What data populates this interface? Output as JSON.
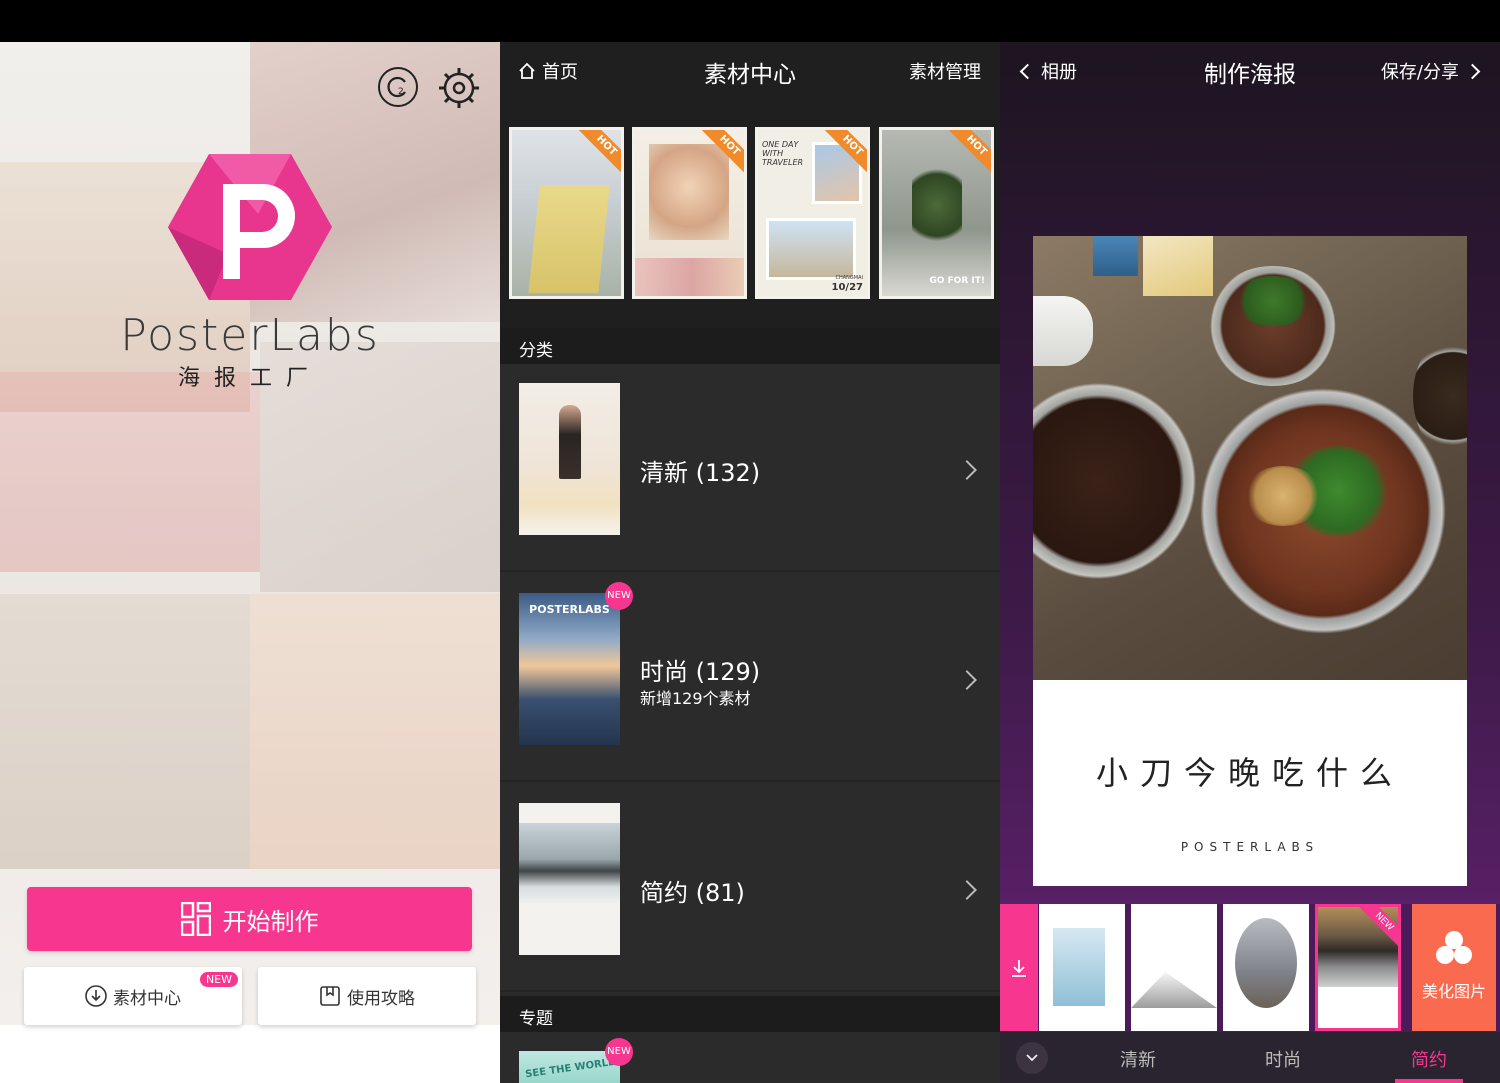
{
  "home": {
    "brand_en": "PosterLabs",
    "brand_cn": "海报工厂",
    "start_label": "开始制作",
    "material_label": "素材中心",
    "material_badge": "NEW",
    "guide_label": "使用攻略",
    "logo_letter": "P"
  },
  "material_center": {
    "home_label": "首页",
    "title": "素材中心",
    "manage_label": "素材管理",
    "hot_badge": "HOT",
    "hot_items": [
      {
        "icon": "poster-street-thumbnail"
      },
      {
        "icon": "poster-girl-hat-thumbnail"
      },
      {
        "icon": "poster-one-day-with-traveler-thumbnail",
        "text": "ONE DAY WITH TRAVELER",
        "date": "10/27",
        "place": "CHANGMAI"
      },
      {
        "icon": "poster-plant-go-for-it-thumbnail",
        "text": "GO FOR IT!"
      }
    ],
    "category_header": "分类",
    "categories": [
      {
        "name": "清新 (132)",
        "sub": "",
        "badge": ""
      },
      {
        "name": "时尚 (129)",
        "sub": "新增129个素材",
        "badge": "NEW",
        "thumb_text": "POSTERLABS"
      },
      {
        "name": "简约 (81)",
        "sub": "",
        "badge": ""
      }
    ],
    "topic_header": "专题",
    "topic_badge": "NEW",
    "topic_thumb_text": "SEE THE WORLD"
  },
  "make_poster": {
    "back_label": "相册",
    "title": "制作海报",
    "save_label": "保存/分享",
    "caption": "小刀今晚吃什么",
    "watermark": "POSTERLABS",
    "template_badge": "NEW",
    "beauty_label": "美化图片",
    "tabs": [
      "清新",
      "时尚",
      "简约"
    ],
    "active_tab": "简约"
  },
  "colors": {
    "accent": "#f7368f",
    "beauty": "#fa6a4e",
    "hot": "#f08a2a"
  }
}
